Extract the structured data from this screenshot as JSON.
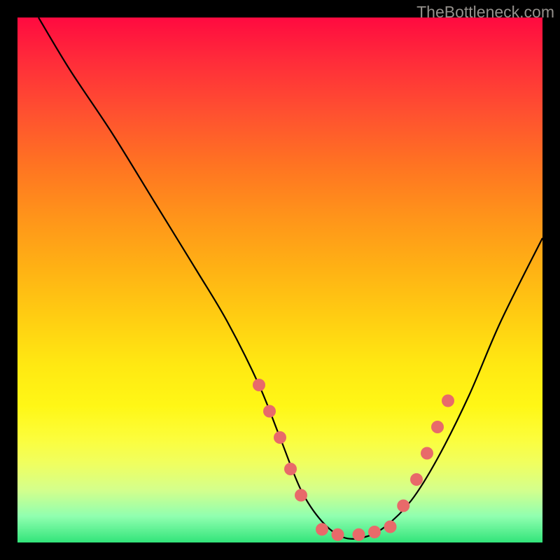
{
  "watermark": "TheBottleneck.com",
  "chart_data": {
    "type": "line",
    "title": "",
    "xlabel": "",
    "ylabel": "",
    "xlim": [
      0,
      100
    ],
    "ylim": [
      0,
      100
    ],
    "curve": {
      "name": "bottleneck-curve",
      "x": [
        4,
        10,
        18,
        26,
        34,
        40,
        46,
        50,
        54,
        58,
        62,
        66,
        70,
        75,
        80,
        86,
        92,
        100
      ],
      "y": [
        100,
        90,
        78,
        65,
        52,
        42,
        30,
        20,
        10,
        4,
        1,
        1,
        3,
        8,
        16,
        28,
        42,
        58
      ]
    },
    "markers": {
      "name": "highlight-dots",
      "color": "#e86a6a",
      "radius": 9,
      "points": [
        {
          "x": 46,
          "y": 30
        },
        {
          "x": 48,
          "y": 25
        },
        {
          "x": 50,
          "y": 20
        },
        {
          "x": 52,
          "y": 14
        },
        {
          "x": 54,
          "y": 9
        },
        {
          "x": 58,
          "y": 2.5
        },
        {
          "x": 61,
          "y": 1.5
        },
        {
          "x": 65,
          "y": 1.5
        },
        {
          "x": 68,
          "y": 2
        },
        {
          "x": 71,
          "y": 3
        },
        {
          "x": 73.5,
          "y": 7
        },
        {
          "x": 76,
          "y": 12
        },
        {
          "x": 78,
          "y": 17
        },
        {
          "x": 80,
          "y": 22
        },
        {
          "x": 82,
          "y": 27
        }
      ]
    }
  }
}
